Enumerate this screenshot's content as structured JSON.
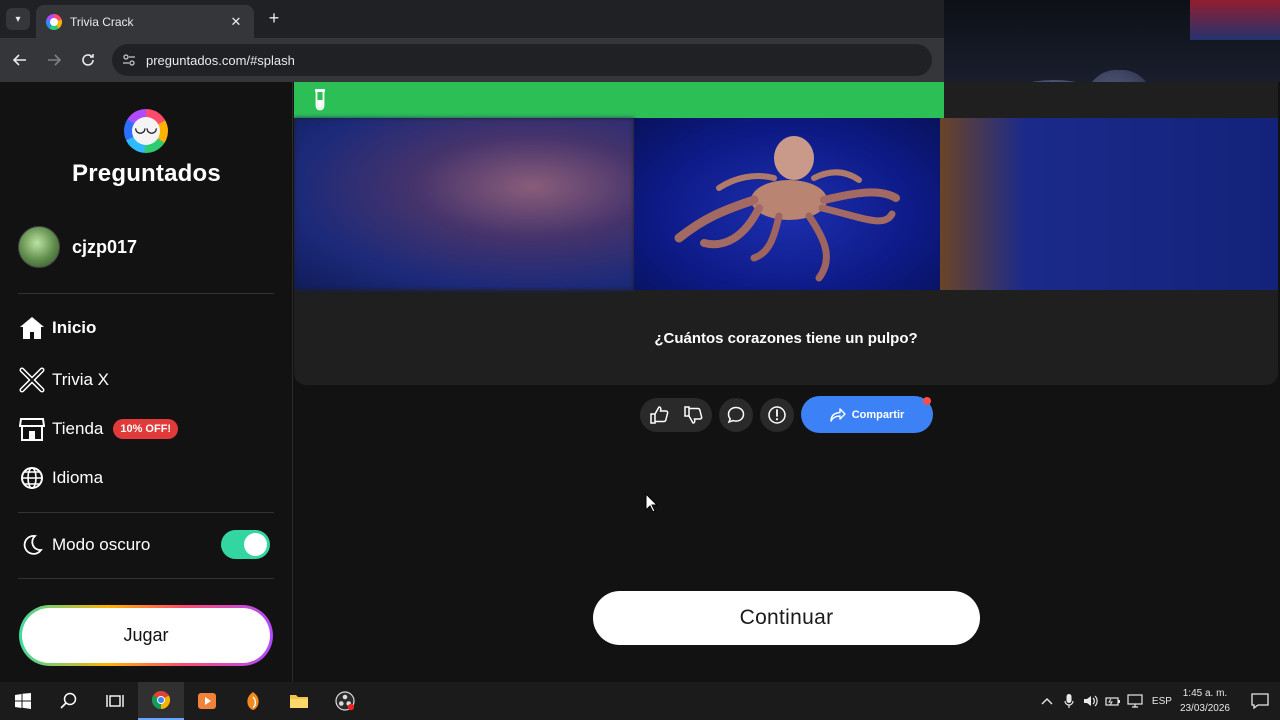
{
  "browser": {
    "tab_title": "Trivia Crack",
    "url": "preguntados.com/#splash"
  },
  "sidebar": {
    "logo_text": "Preguntados",
    "username": "cjzp017",
    "menu": [
      {
        "label": "Inicio",
        "icon": "home-icon"
      },
      {
        "label": "Trivia X",
        "icon": "trivia-x-icon"
      },
      {
        "label": "Tienda",
        "icon": "store-icon",
        "badge": "10% OFF!"
      },
      {
        "label": "Idioma",
        "icon": "globe-icon"
      }
    ],
    "dark_mode_label": "Modo oscuro",
    "dark_mode_on": true,
    "play_label": "Jugar"
  },
  "question": {
    "category_color": "#2bbf55",
    "category_icon": "test-tube-icon",
    "text": "¿Cuántos corazones tiene un pulpo?"
  },
  "actions": {
    "share_label": "Compartir"
  },
  "continue_label": "Continuar",
  "taskbar": {
    "lang": "ESP",
    "time": "1:45 a. m.",
    "date": "23/03/2026"
  },
  "colors": {
    "accent_green": "#2bbf55",
    "share_blue": "#3c82f6",
    "toggle_green": "#33d6a0",
    "badge_red": "#e03a3a"
  }
}
